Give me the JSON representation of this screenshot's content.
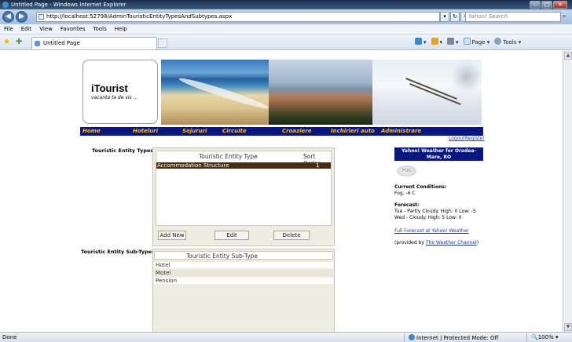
{
  "window": {
    "title": "Untitled Page - Windows Internet Explorer",
    "min": "–",
    "max": "□",
    "close": "✕"
  },
  "address_bar": {
    "url": "http://localhost:52798/AdminTouristicEntityTypesAndSubtypes.aspx",
    "search_placeholder": "Yahoo! Search"
  },
  "menu": [
    "File",
    "Edit",
    "View",
    "Favorites",
    "Tools",
    "Help"
  ],
  "tab": {
    "label": "Untitled Page"
  },
  "commands": [
    "Page ▾",
    "Tools ▾"
  ],
  "site": {
    "logo_title": "iTourist",
    "logo_subtitle": "vacanta ta de vis ...",
    "nav": [
      "Home",
      "Hoteluri",
      "Sejururi",
      "Circuite",
      "Croaziere",
      "Inchirieri auto",
      "Administrare"
    ],
    "logout": "Logout",
    "register": "Register"
  },
  "types_section": {
    "label": "Touristic Entity Types :",
    "col_type": "Touristic Entity Type",
    "col_order": "Sort Order",
    "rows": [
      {
        "type": "Accommodation Structure",
        "order": "1"
      }
    ],
    "buttons": {
      "add": "Add New",
      "edit": "Edit",
      "delete": "Delete"
    }
  },
  "subtypes_section": {
    "label": "Touristic Entity Sub-Types :",
    "col_subtype": "Touristic Entity Sub-Type",
    "rows": [
      "Hotel",
      "Motel",
      "Pension"
    ]
  },
  "weather": {
    "title": "Yahoo! Weather for Oradea-Mare, RO",
    "icon_name": "cloud-icon",
    "icon_text": "FOG",
    "current_label": "Current Conditions:",
    "current_value": "Fog, -6 C",
    "forecast_label": "Forecast:",
    "forecast_1": "Tue - Partly Cloudy. High: 0 Low: -5",
    "forecast_2": "Wed - Cloudy. High: 5 Low: 0",
    "full_forecast": "Full Forecast at Yahoo! Weather",
    "provided_prefix": "(provided by ",
    "provided_link": "The Weather Channel",
    "provided_suffix": ")"
  },
  "status": {
    "left": "Done",
    "zone": "Internet | Protected Mode: Off",
    "zoom": "100%"
  }
}
